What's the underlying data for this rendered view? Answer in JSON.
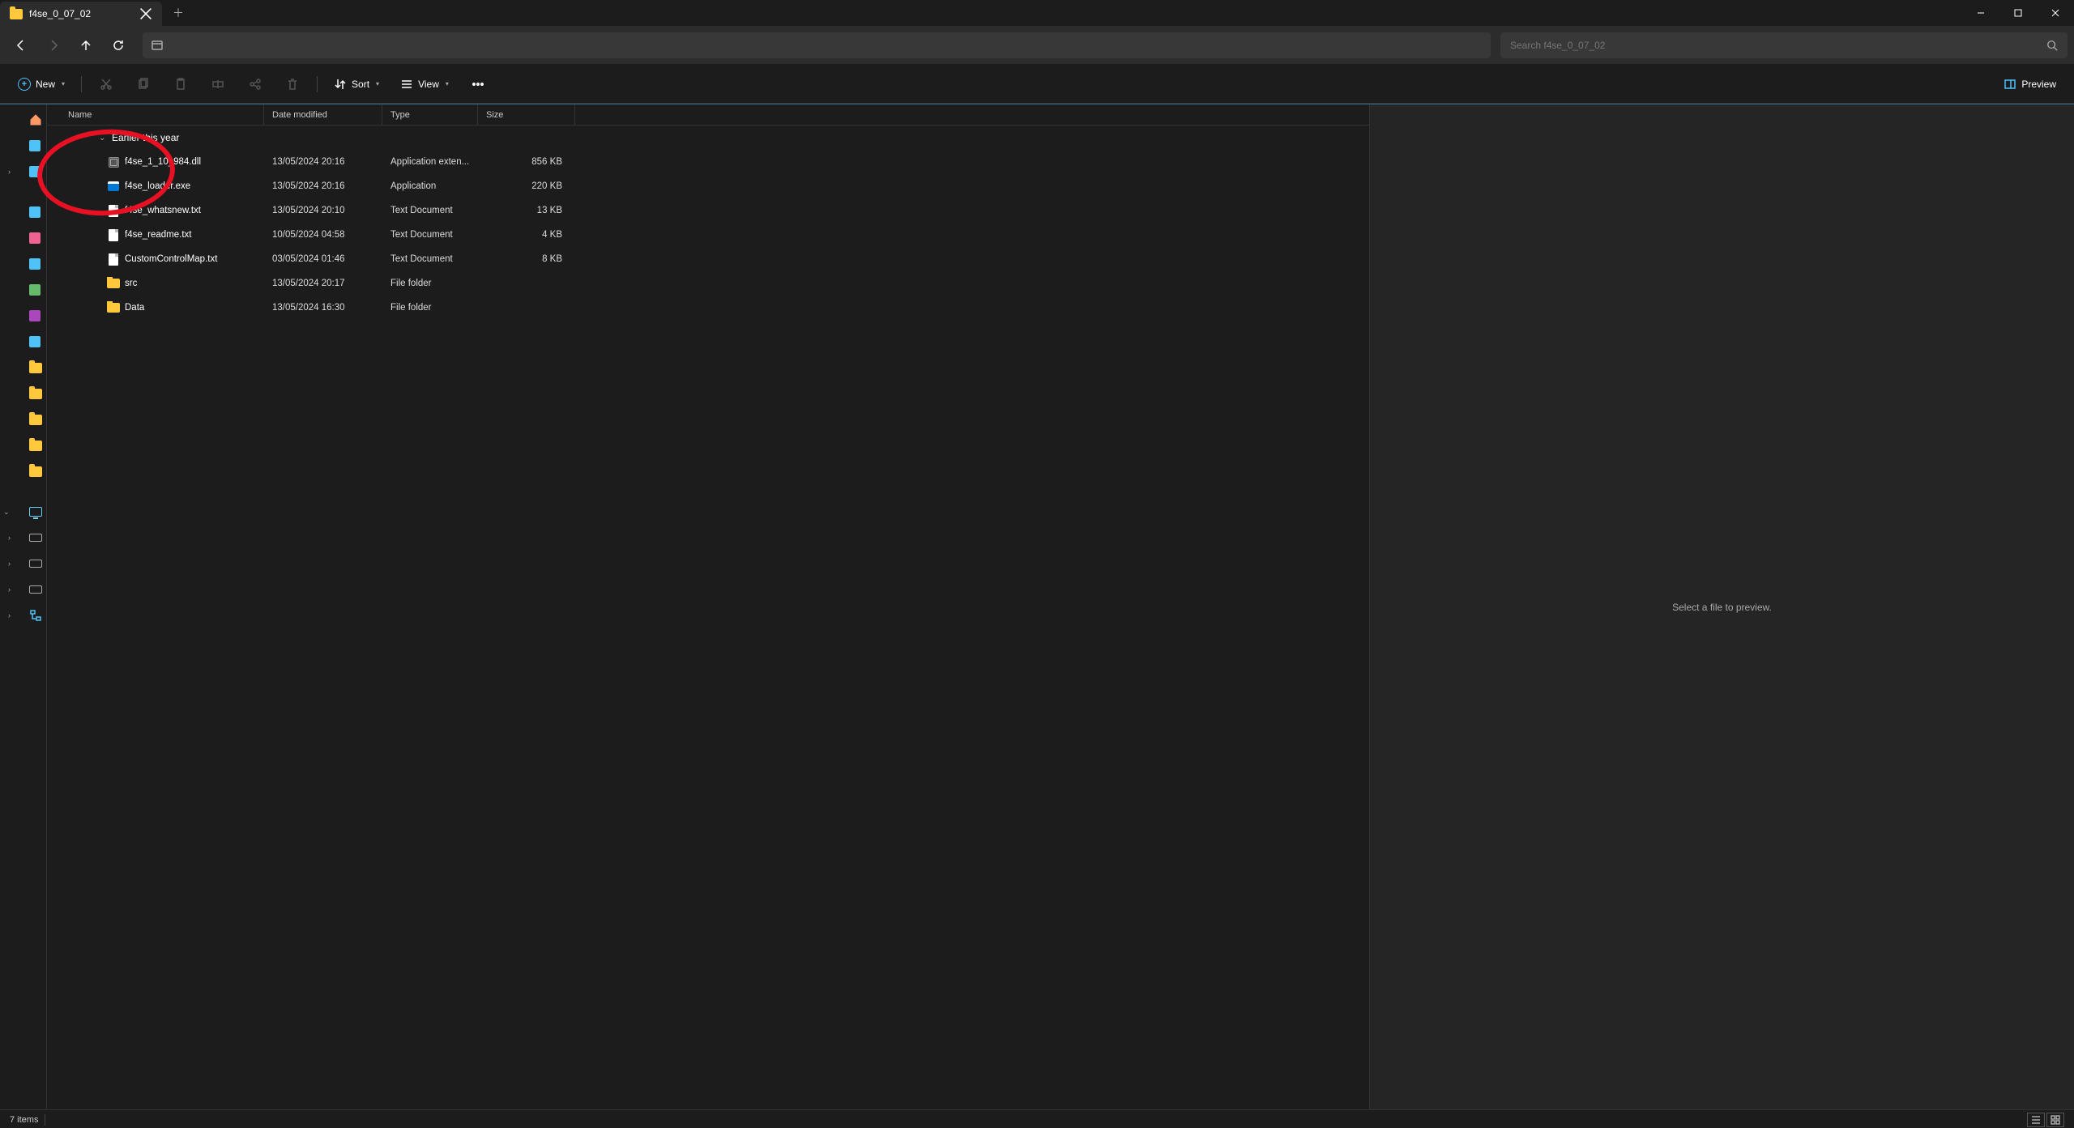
{
  "window": {
    "tab_title": "f4se_0_07_02",
    "new_label": "New",
    "sort_label": "Sort",
    "view_label": "View",
    "preview_label": "Preview",
    "search_placeholder": "Search f4se_0_07_02"
  },
  "columns": {
    "name": "Name",
    "date": "Date modified",
    "type": "Type",
    "size": "Size"
  },
  "group": {
    "label": "Earlier this year"
  },
  "files": [
    {
      "name": "f4se_1_10_984.dll",
      "date": "13/05/2024 20:16",
      "type": "Application exten...",
      "size": "856 KB",
      "icon": "dll"
    },
    {
      "name": "f4se_loader.exe",
      "date": "13/05/2024 20:16",
      "type": "Application",
      "size": "220 KB",
      "icon": "exe"
    },
    {
      "name": "f4se_whatsnew.txt",
      "date": "13/05/2024 20:10",
      "type": "Text Document",
      "size": "13 KB",
      "icon": "doc"
    },
    {
      "name": "f4se_readme.txt",
      "date": "10/05/2024 04:58",
      "type": "Text Document",
      "size": "4 KB",
      "icon": "doc"
    },
    {
      "name": "CustomControlMap.txt",
      "date": "03/05/2024 01:46",
      "type": "Text Document",
      "size": "8 KB",
      "icon": "doc"
    },
    {
      "name": "src",
      "date": "13/05/2024 20:17",
      "type": "File folder",
      "size": "",
      "icon": "folder"
    },
    {
      "name": "Data",
      "date": "13/05/2024 16:30",
      "type": "File folder",
      "size": "",
      "icon": "folder"
    }
  ],
  "preview": {
    "empty_text": "Select a file to preview."
  },
  "status": {
    "count": "7 items"
  },
  "sidebar": {
    "quick_colors": [
      "#ff7043",
      "#4fc3f7",
      "#4fc3f7",
      "#4fc3f7",
      "#f06292",
      "#4fc3f7",
      "#66bb6a",
      "#ab47bc",
      "#4fc3f7"
    ]
  }
}
